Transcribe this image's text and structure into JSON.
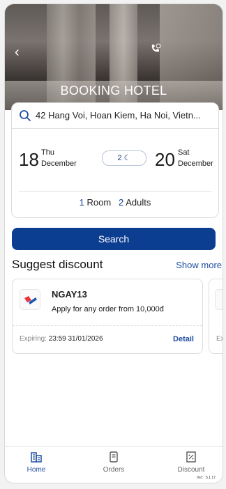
{
  "header": {
    "title": "BOOKING HOTEL",
    "back_icon": "chevron-left-icon",
    "call_icon": "phone-call-icon"
  },
  "search": {
    "address": "42 Hang Voi, Hoan Kiem, Ha Noi, Vietn..."
  },
  "dates": {
    "checkin_day": "18",
    "checkin_weekday": "Thu",
    "checkin_month": "December",
    "nights": "2",
    "checkout_day": "20",
    "checkout_weekday": "Sat",
    "checkout_month": "December"
  },
  "guests": {
    "rooms_count": "1",
    "rooms_label": "Room",
    "adults_count": "2",
    "adults_label": "Adults"
  },
  "search_button": "Search",
  "discounts": {
    "section_title": "Suggest discount",
    "show_more": "Show more",
    "items": [
      {
        "code": "NGAY13",
        "description": "Apply for any order from 10,000đ",
        "expiring_label": "Expiring:",
        "expiring_value": "23:59 31/01/2026",
        "detail": "Detail"
      },
      {
        "expiring_label": "Ex"
      }
    ]
  },
  "tabs": [
    {
      "label": "Home",
      "icon": "building-icon"
    },
    {
      "label": "Orders",
      "icon": "receipt-icon"
    },
    {
      "label": "Discount",
      "icon": "discount-voucher-icon"
    }
  ],
  "version": "Ver: : 5.1.17",
  "colors": {
    "primary": "#0b3d91",
    "link": "#1f4fa3",
    "logo_red": "#e8343a",
    "logo_blue": "#1a56b5"
  }
}
